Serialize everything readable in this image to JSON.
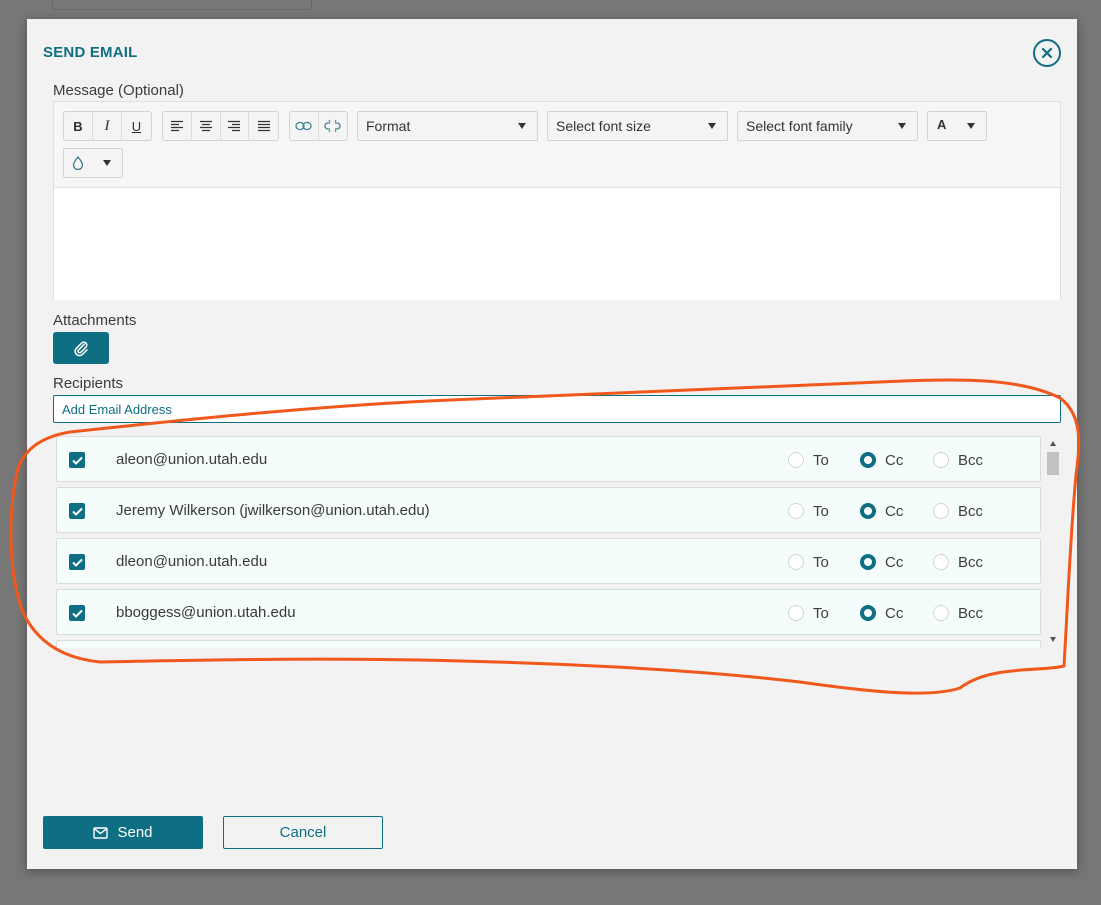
{
  "modal": {
    "title": "SEND EMAIL",
    "close_icon": "close-circle-icon"
  },
  "message": {
    "label": "Message (Optional)",
    "toolbar": {
      "text_styles": [
        {
          "label": "B",
          "icon": "bold-icon"
        },
        {
          "label": "I",
          "icon": "italic-icon"
        },
        {
          "label": "U",
          "icon": "underline-icon"
        }
      ],
      "align_icons": [
        "align-left-icon",
        "align-center-icon",
        "align-right-icon",
        "align-justify-icon"
      ],
      "link_icons": [
        "link-icon",
        "unlink-icon"
      ],
      "format_select": "Format",
      "font_size_select": "Select font size",
      "font_family_select": "Select font family",
      "font_color_label": "A",
      "bg_color_icon": "droplet-icon"
    },
    "body": ""
  },
  "attachments": {
    "label": "Attachments",
    "button_icon": "paperclip-icon"
  },
  "recipients": {
    "label": "Recipients",
    "input_placeholder": "Add Email Address",
    "option_labels": {
      "to": "To",
      "cc": "Cc",
      "bcc": "Bcc"
    },
    "list": [
      {
        "name": "aleon@union.utah.edu",
        "checked": true,
        "type": "Cc"
      },
      {
        "name": "Jeremy Wilkerson (jwilkerson@union.utah.edu)",
        "checked": true,
        "type": "Cc"
      },
      {
        "name": "dleon@union.utah.edu",
        "checked": true,
        "type": "Cc"
      },
      {
        "name": "bboggess@union.utah.edu",
        "checked": true,
        "type": "Cc"
      }
    ]
  },
  "actions": {
    "send_label": "Send",
    "send_icon": "envelope-icon",
    "cancel_label": "Cancel"
  },
  "colors": {
    "accent": "#0f6f82",
    "annotation": "#f0581c",
    "overlay": "#777777",
    "modal_bg": "#f2f2f2"
  }
}
